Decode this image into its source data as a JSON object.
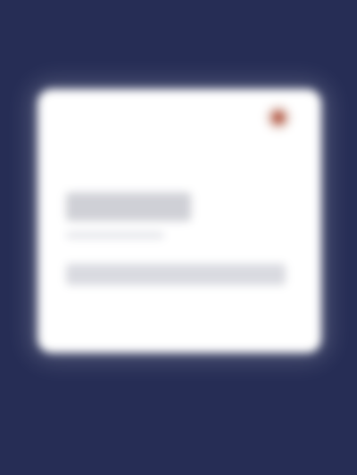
{
  "screen": {
    "background_color": "#262d55",
    "note_blur": true
  },
  "modal": {
    "title": "",
    "text": "",
    "close_icon": "close-icon",
    "accent_color": "#b0533e"
  }
}
